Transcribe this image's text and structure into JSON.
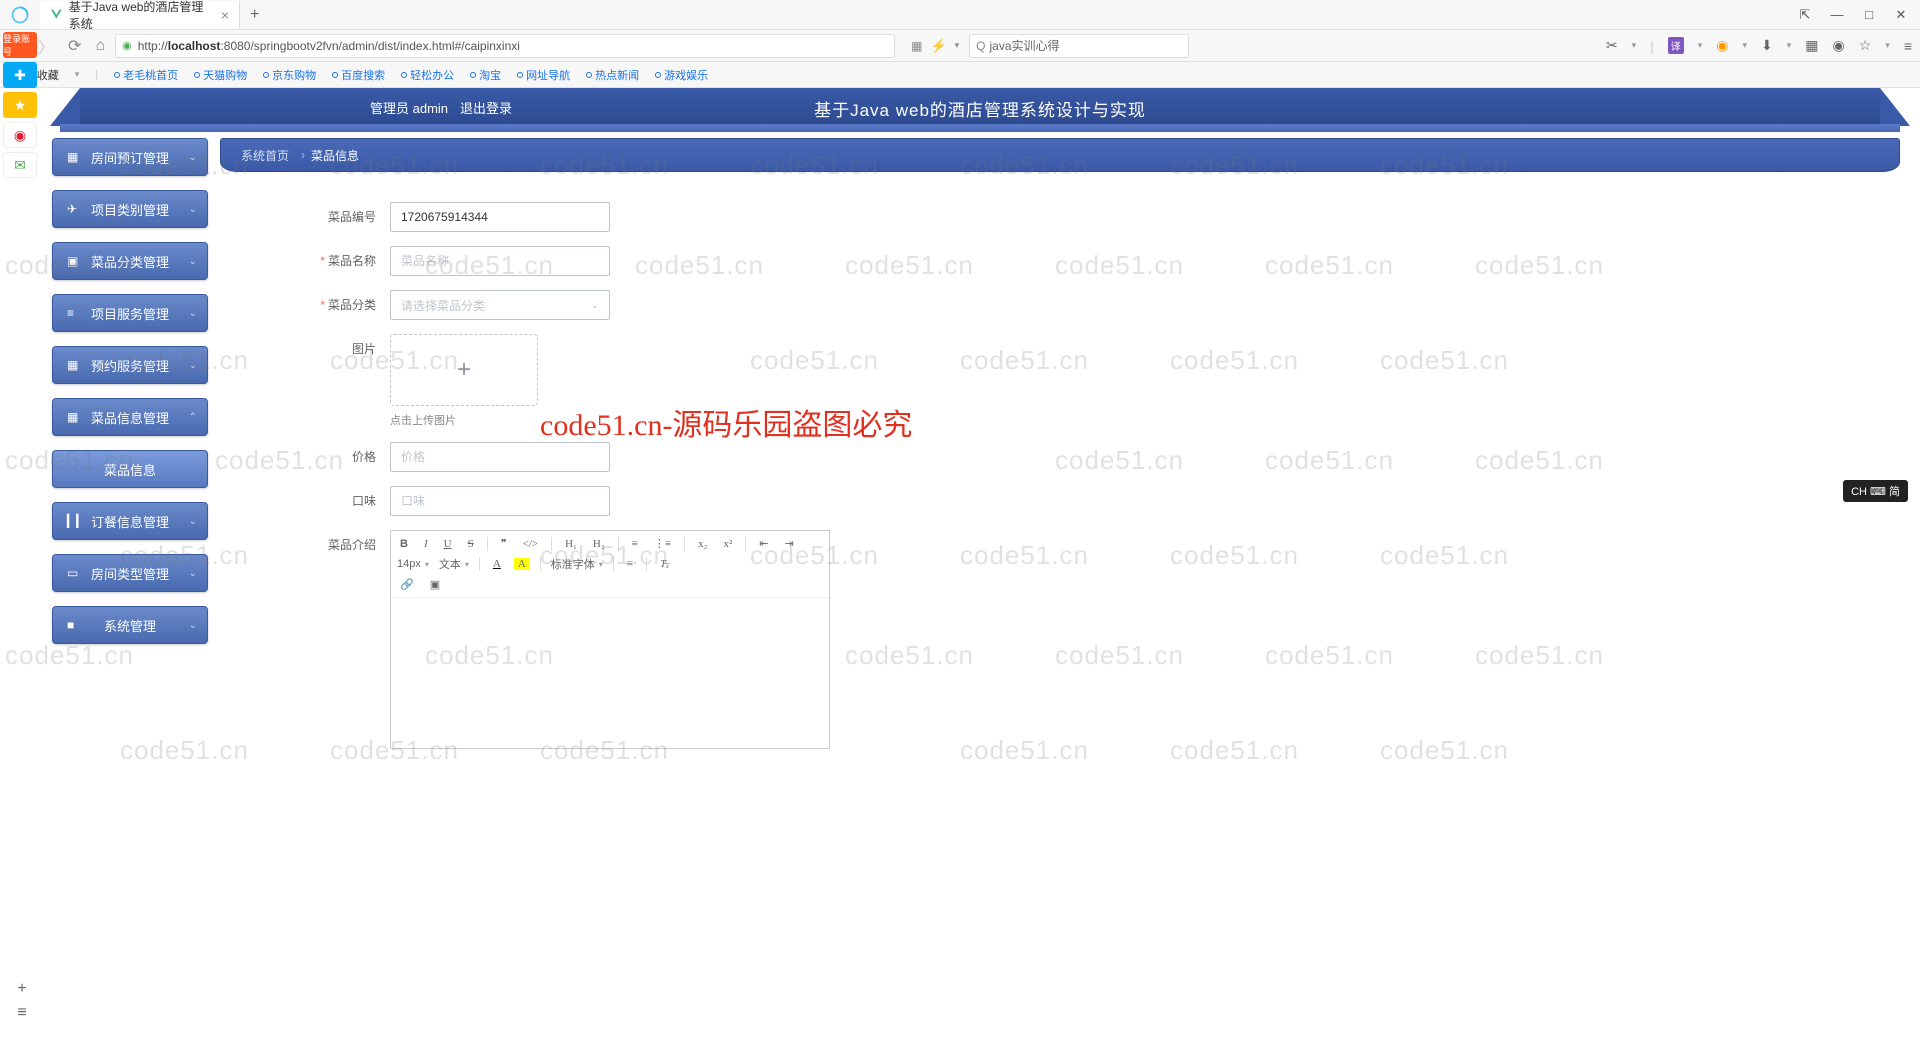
{
  "browser": {
    "tab_title": "基于Java web的酒店管理系统",
    "url_prefix": "http://",
    "url_host": "localhost",
    "url_rest": ":8080/springbootv2fvn/admin/dist/index.html#/caipinxinxi",
    "search_value": "java实训心得"
  },
  "bookmarks": {
    "fav_label": "收藏",
    "items": [
      "老毛桃首页",
      "天猫购物",
      "京东购物",
      "百度搜索",
      "轻松办公",
      "淘宝",
      "网址导航",
      "热点新闻",
      "游戏娱乐"
    ]
  },
  "header": {
    "admin_label": "管理员 admin",
    "logout_label": "退出登录",
    "title": "基于Java web的酒店管理系统设计与实现"
  },
  "sidebar": {
    "items": [
      {
        "label": "房间预订管理",
        "icon": "▦"
      },
      {
        "label": "项目类别管理",
        "icon": "✈"
      },
      {
        "label": "菜品分类管理",
        "icon": "▣"
      },
      {
        "label": "项目服务管理",
        "icon": "≡"
      },
      {
        "label": "预约服务管理",
        "icon": "▦"
      },
      {
        "label": "菜品信息管理",
        "icon": "▦",
        "expanded": true
      },
      {
        "label": "菜品信息",
        "sub": true
      },
      {
        "label": "订餐信息管理",
        "icon": "▎▎"
      },
      {
        "label": "房间类型管理",
        "icon": "▭"
      },
      {
        "label": "系统管理",
        "icon": "■"
      }
    ]
  },
  "breadcrumb": {
    "home": "系统首页",
    "current": "菜品信息"
  },
  "form": {
    "code": {
      "label": "菜品编号",
      "value": "1720675914344"
    },
    "name": {
      "label": "菜品名称",
      "placeholder": "菜品名称"
    },
    "category": {
      "label": "菜品分类",
      "placeholder": "请选择菜品分类"
    },
    "image": {
      "label": "图片",
      "hint": "点击上传图片"
    },
    "price": {
      "label": "价格",
      "placeholder": "价格"
    },
    "taste": {
      "label": "口味",
      "placeholder": "口味"
    },
    "intro": {
      "label": "菜品介绍"
    }
  },
  "editor": {
    "font_size": "14px",
    "font_style": "文本",
    "font_family": "标准字体"
  },
  "watermark": {
    "text": "code51.cn",
    "red": "code51.cn-源码乐园盗图必究"
  },
  "ime": {
    "text": "CH ⌨ 简"
  },
  "ql_badge": "登录账号"
}
